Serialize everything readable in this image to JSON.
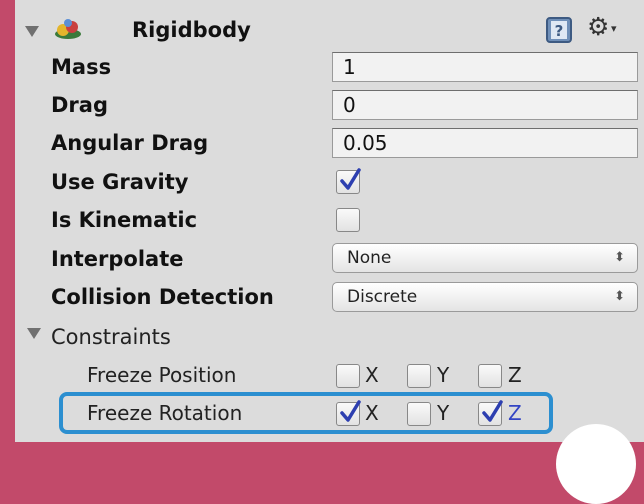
{
  "header": {
    "title": "Rigidbody",
    "foldout_icon": "triangle-down-icon",
    "component_icon": "rigidbody-icon",
    "help_icon": "help-book-icon",
    "settings_icon": "gear-icon"
  },
  "fields": {
    "mass": {
      "label": "Mass",
      "value": "1"
    },
    "drag": {
      "label": "Drag",
      "value": "0"
    },
    "angular_drag": {
      "label": "Angular Drag",
      "value": "0.05"
    },
    "use_gravity": {
      "label": "Use Gravity",
      "checked": true
    },
    "is_kinematic": {
      "label": "Is Kinematic",
      "checked": false
    },
    "interpolate": {
      "label": "Interpolate",
      "value": "None"
    },
    "collision_detection": {
      "label": "Collision Detection",
      "value": "Discrete"
    }
  },
  "constraints": {
    "label": "Constraints",
    "freeze_position": {
      "label": "Freeze Position",
      "x": {
        "label": "X",
        "checked": false
      },
      "y": {
        "label": "Y",
        "checked": false
      },
      "z": {
        "label": "Z",
        "checked": false
      }
    },
    "freeze_rotation": {
      "label": "Freeze Rotation",
      "x": {
        "label": "X",
        "checked": true
      },
      "y": {
        "label": "Y",
        "checked": false
      },
      "z": {
        "label": "Z",
        "checked": true
      }
    }
  },
  "colors": {
    "background": "#c24a6a",
    "panel": "#dcdcdc",
    "highlight": "#2c8fd0",
    "checked_axis": "#3344c4"
  }
}
